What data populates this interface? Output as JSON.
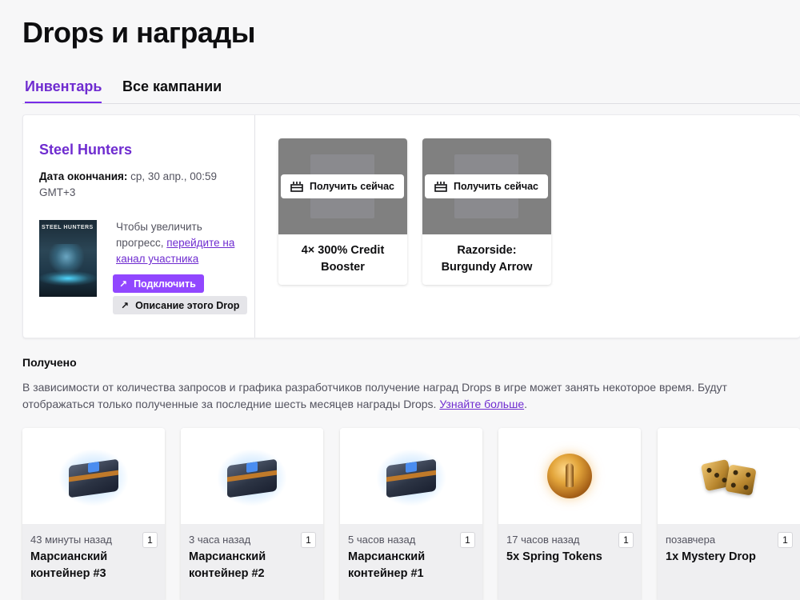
{
  "page": {
    "title": "Drops и награды"
  },
  "tabs": [
    {
      "label": "Инвентарь",
      "active": true
    },
    {
      "label": "Все кампании",
      "active": false
    }
  ],
  "campaign": {
    "name": "Steel Hunters",
    "end_date_label": "Дата окончания:",
    "end_date_value": " ср, 30 апр., 00:59 GMT+3",
    "box_art_logo": "STEEL HUNTERS",
    "hint_text": "Чтобы увеличить прогресс, ",
    "hint_link": "перейдите на канал участника",
    "connect_label": "Подключить",
    "details_label": "Описание этого Drop",
    "rewards": [
      {
        "name": "4× 300% Credit Booster",
        "claim_label": "Получить сейчас"
      },
      {
        "name": "Razorside: Burgundy Arrow",
        "claim_label": "Получить сейчас"
      }
    ]
  },
  "received": {
    "title": "Получено",
    "description": "В зависимости от количества запросов и графика разработчиков получение наград Drops в игре может занять некоторое время. Будут отображаться только полученные за последние шесть месяцев награды Drops. ",
    "learn_more": "Узнайте больше",
    "trailing": ".",
    "items": [
      {
        "time": "43 минуты назад",
        "count": "1",
        "name": "Марсианский контейнер #3",
        "icon": "chest-icon"
      },
      {
        "time": "3 часа назад",
        "count": "1",
        "name": "Марсианский контейнер #2",
        "icon": "chest-icon"
      },
      {
        "time": "5 часов назад",
        "count": "1",
        "name": "Марсианский контейнер #1",
        "icon": "chest-icon"
      },
      {
        "time": "17 часов назад",
        "count": "1",
        "name": "5x Spring Tokens",
        "icon": "token-coin-icon"
      },
      {
        "time": "позавчера",
        "count": "1",
        "name": "1x Mystery Drop",
        "icon": "dice-icon"
      }
    ]
  },
  "colors": {
    "accent": "#772ce8",
    "accent_text": "#6f2cd0",
    "button_primary": "#9147ff"
  }
}
